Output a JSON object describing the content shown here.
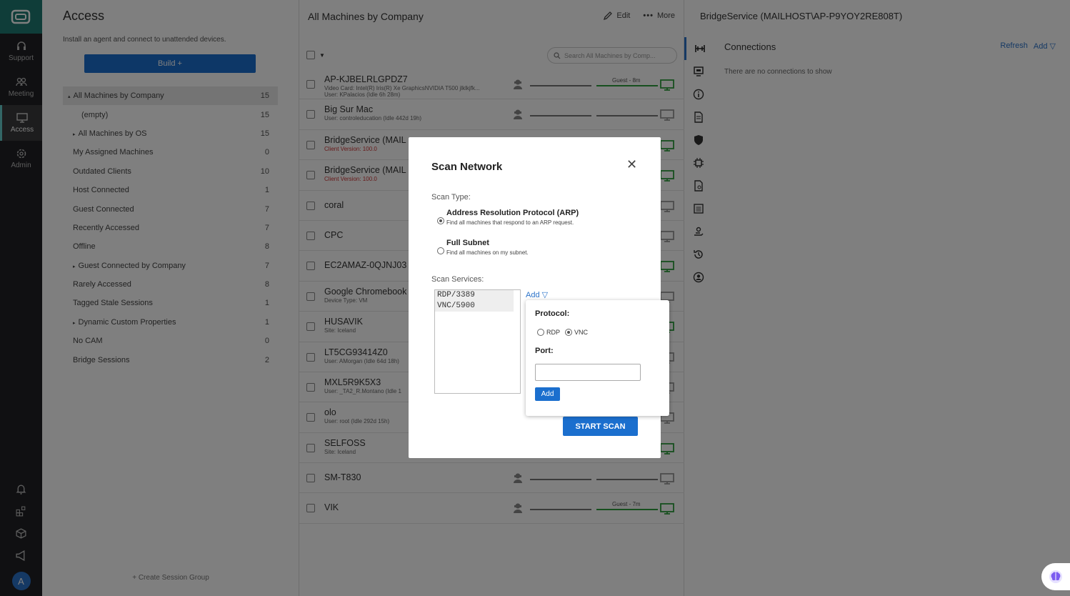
{
  "nav": {
    "items": [
      {
        "label": "Support",
        "icon": "headset-icon"
      },
      {
        "label": "Meeting",
        "icon": "people-icon"
      },
      {
        "label": "Access",
        "icon": "monitor-icon"
      },
      {
        "label": "Admin",
        "icon": "gear-icon"
      }
    ],
    "avatar_letter": "A"
  },
  "left": {
    "title": "Access",
    "subtitle": "Install an agent and connect to unattended devices.",
    "build_label": "Build +",
    "groups": [
      {
        "label": "All Machines by Company",
        "count": "15",
        "caret": "▴"
      },
      {
        "label": "(empty)",
        "count": "15",
        "caret": ""
      },
      {
        "label": "All Machines by OS",
        "count": "15",
        "caret": "▸"
      },
      {
        "label": "My Assigned Machines",
        "count": "0",
        "caret": ""
      },
      {
        "label": "Outdated Clients",
        "count": "10",
        "caret": ""
      },
      {
        "label": "Host Connected",
        "count": "1",
        "caret": ""
      },
      {
        "label": "Guest Connected",
        "count": "7",
        "caret": ""
      },
      {
        "label": "Recently Accessed",
        "count": "7",
        "caret": ""
      },
      {
        "label": "Offline",
        "count": "8",
        "caret": ""
      },
      {
        "label": "Guest Connected by Company",
        "count": "7",
        "caret": "▸"
      },
      {
        "label": "Rarely Accessed",
        "count": "8",
        "caret": ""
      },
      {
        "label": "Tagged Stale Sessions",
        "count": "1",
        "caret": ""
      },
      {
        "label": "Dynamic Custom Properties",
        "count": "1",
        "caret": "▸"
      },
      {
        "label": "No CAM",
        "count": "0",
        "caret": ""
      },
      {
        "label": "Bridge Sessions",
        "count": "2",
        "caret": ""
      }
    ],
    "create_group": "+ Create Session Group"
  },
  "middle": {
    "title": "All Machines by Company",
    "edit_label": "Edit",
    "more_label": "More",
    "search_placeholder": "Search All Machines by Comp...",
    "machines": [
      {
        "name": "AP-KJBELRLGPDZ7",
        "detail": "Video Card: Intel(R) Iris(R) Xe GraphicsNVIDIA T500 jlklkjfk...",
        "detail2": "User: KPalacios (Idle 6h 28m)",
        "guest": "Guest - 8m",
        "online": true
      },
      {
        "name": "Big Sur Mac",
        "detail": "User: controleducation (Idle 442d 19h)",
        "detail2": "",
        "guest": "",
        "online": false
      },
      {
        "name": "BridgeService (MAIL",
        "detail": "Client Version: 100.0",
        "detail2": "",
        "guest": "",
        "online": true,
        "red": true
      },
      {
        "name": "BridgeService (MAIL",
        "detail": "Client Version: 100.0",
        "detail2": "",
        "guest": "",
        "online": true,
        "red": true
      },
      {
        "name": "coral",
        "detail": "",
        "detail2": "",
        "guest": "",
        "online": false
      },
      {
        "name": "CPC",
        "detail": "",
        "detail2": "",
        "guest": "",
        "online": false
      },
      {
        "name": "EC2AMAZ-0QJNJ03",
        "detail": "",
        "detail2": "",
        "guest": "",
        "online": true
      },
      {
        "name": "Google Chromebook",
        "detail": "Device Type: VM",
        "detail2": "",
        "guest": "",
        "online": false
      },
      {
        "name": "HUSAVIK",
        "detail": "Site: Iceland",
        "detail2": "",
        "guest": "",
        "online": true
      },
      {
        "name": "LT5CG93414Z0",
        "detail": "User: AMorgan (Idle 64d 18h)",
        "detail2": "",
        "guest": "",
        "online": false
      },
      {
        "name": "MXL5R9K5X3",
        "detail": "User: _TA2_R.Montano (Idle 1",
        "detail2": "",
        "guest": "",
        "online": false
      },
      {
        "name": "olo",
        "detail": "User: root (Idle 292d 15h)",
        "detail2": "",
        "guest": "",
        "online": false
      },
      {
        "name": "SELFOSS",
        "detail": "Site: Iceland",
        "detail2": "",
        "guest": "",
        "online": true
      },
      {
        "name": "SM-T830",
        "detail": "",
        "detail2": "",
        "guest": "",
        "online": false
      },
      {
        "name": "VIK",
        "detail": "",
        "detail2": "",
        "guest": "Guest - 7m",
        "online": true
      }
    ]
  },
  "right": {
    "title": "BridgeService (MAILHOST\\AP-P9YOY2RE808T)",
    "connections_title": "Connections",
    "refresh_label": "Refresh",
    "add_label": "Add ▽",
    "empty_text": "There are no connections to show"
  },
  "modal": {
    "title": "Scan Network",
    "scan_type_label": "Scan Type:",
    "options": [
      {
        "title": "Address Resolution Protocol (ARP)",
        "desc": "Find all machines that respond to an ARP request.",
        "selected": true
      },
      {
        "title": "Full Subnet",
        "desc": "Find all machines on my subnet.",
        "selected": false
      }
    ],
    "scan_services_label": "Scan Services:",
    "services": [
      "RDP/3389",
      "VNC/5900"
    ],
    "add_link": "Add ▽",
    "start_label": "START SCAN"
  },
  "popup": {
    "protocol_label": "Protocol:",
    "rdp_label": "RDP",
    "vnc_label": "VNC",
    "port_label": "Port:",
    "port_value": "",
    "add_label": "Add"
  },
  "colors": {
    "accent": "#1b6fce",
    "online": "#2e9e3e",
    "nav_bg": "#202124",
    "logo_bg": "#1f7a73"
  }
}
